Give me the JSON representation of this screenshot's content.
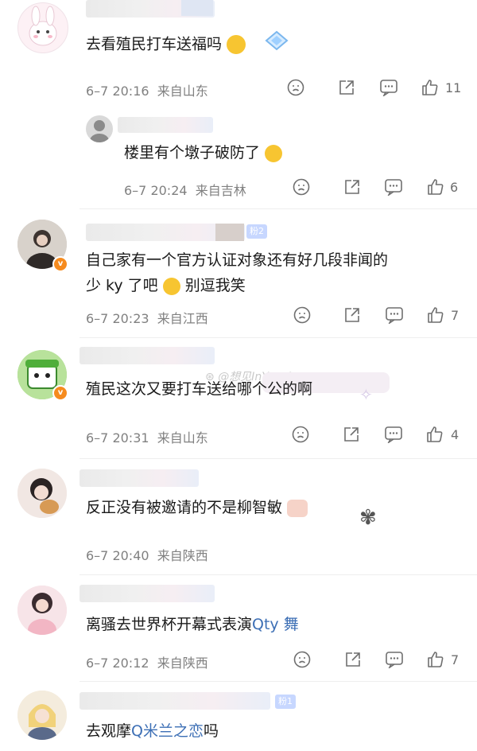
{
  "colors": {
    "link": "#3d6fb5",
    "meta": "#808080",
    "icon": "#6f6f6f",
    "vbadge": "#f68b1e"
  },
  "watermark": "@想见InYourArea",
  "comments": [
    {
      "text": "去看殖民打车送福吗",
      "time": "6–7 20:16",
      "location": "来自山东",
      "likes": "11"
    },
    {
      "text": "楼里有个墩子破防了",
      "time": "6–7 20:24",
      "location": "来自吉林",
      "likes": "6"
    },
    {
      "text_line1": "自己家有一个官方认证对象还有好几段非闻的",
      "text_line2a": "少 ky 了吧",
      "text_line2b": "别逗我笑",
      "fan_badge": "粉2",
      "time": "6–7 20:23",
      "location": "来自江西",
      "likes": "7"
    },
    {
      "text": "殖民这次又要打车送给哪个公的啊",
      "time": "6–7 20:31",
      "location": "来自山东",
      "likes": "4"
    },
    {
      "text": "反正没有被邀请的不是柳智敏",
      "time": "6–7 20:40",
      "location": "来自陕西",
      "likes": ""
    },
    {
      "text": "离骚去世界杯开幕式表演",
      "search_link": "ty 舞",
      "time": "6–7 20:12",
      "location": "来自陕西",
      "likes": "7"
    },
    {
      "text": "去观摩",
      "search_link": "米兰之恋",
      "text_after": "吗",
      "fan_badge": "粉1"
    }
  ]
}
